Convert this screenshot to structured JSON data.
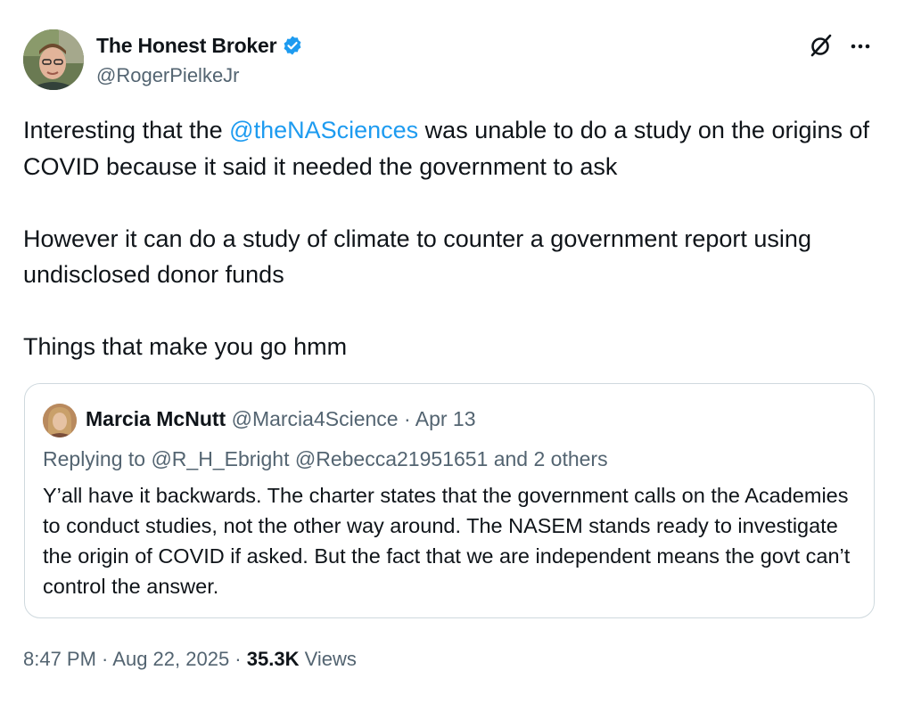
{
  "author": {
    "name": "The Honest Broker",
    "handle": "@RogerPielkeJr",
    "verified": true,
    "avatar_icon": "avatar-photo"
  },
  "tweet": {
    "line1_before": "Interesting that the ",
    "line1_mention": "@theNASciences",
    "line1_after": " was unable to do a study on the origins of COVID because it said it needed the government to ask",
    "para2": "However it can do a study of climate to counter a government report using undisclosed donor funds",
    "para3": "Things that make you go hmm"
  },
  "quote": {
    "name": "Marcia McNutt",
    "handle": "@Marcia4Science",
    "separator": " · ",
    "date": "Apr 13",
    "replying_to": "Replying to @R_H_Ebright @Rebecca21951651 and 2 others",
    "text": "Y’all have it backwards. The charter  states that the government calls on the Academies to conduct studies, not the other way around. The NASEM stands ready to investigate the origin of COVID if asked. But the fact that we are independent means the govt can’t control the answer."
  },
  "footer": {
    "time": "8:47 PM",
    "separator": " · ",
    "date": "Aug 22, 2025",
    "views_count": "35.3K",
    "views_label": " Views"
  },
  "icons": {
    "grok": "grok-icon",
    "more": "more-icon",
    "verified": "verified-badge-icon"
  },
  "colors": {
    "link": "#1d9bf0",
    "verified": "#1d9bf0",
    "secondary_text": "#536471",
    "border": "#cfd9de"
  }
}
